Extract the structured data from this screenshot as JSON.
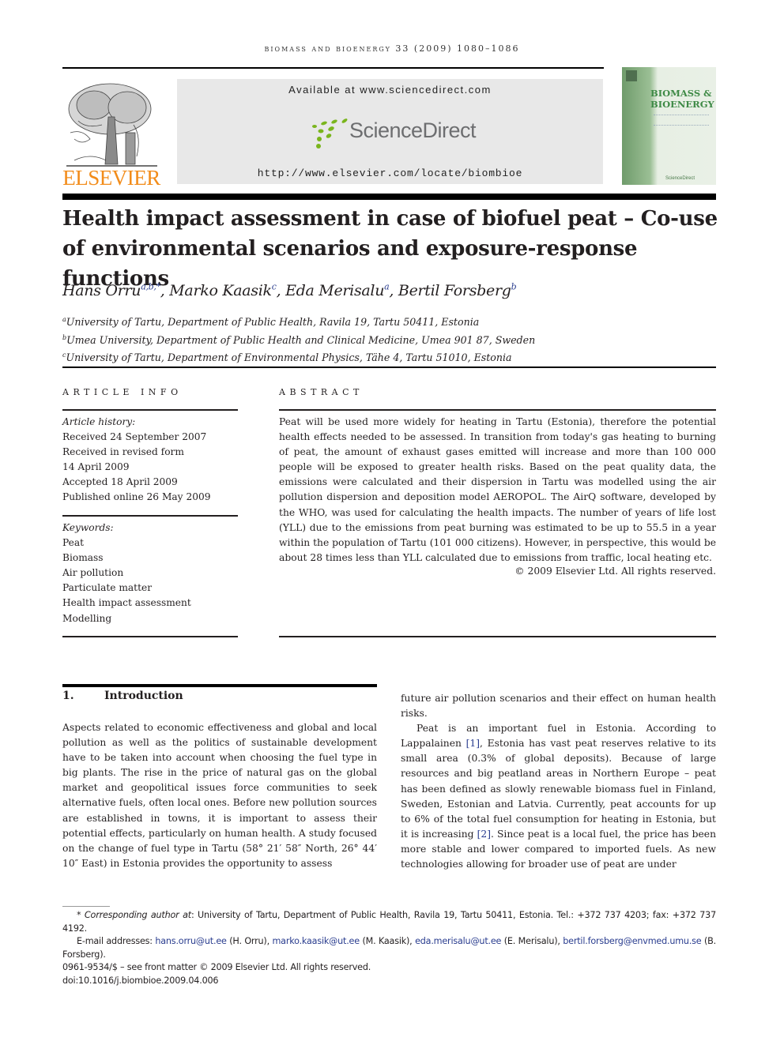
{
  "running_head": "biomass and bioenergy 33 (2009) 1080–1086",
  "publisher": {
    "name": "ELSEVIER",
    "brand_color": "#f28c1a"
  },
  "sciencedirect": {
    "available_at": "Available at www.sciencedirect.com",
    "logo_text": "ScienceDirect",
    "logo_color": "#7ab51d",
    "journal_url": "http://www.elsevier.com/locate/biombioe"
  },
  "journal_cover": {
    "title_line1": "BIOMASS &",
    "title_line2": "BIOENERGY",
    "footer": "ScienceDirect"
  },
  "article": {
    "title": "Health impact assessment in case of biofuel peat – Co-use of environmental scenarios and exposure-response functions",
    "authors": [
      {
        "name": "Hans Orru",
        "sup": "a,b,*",
        "sep": ", "
      },
      {
        "name": "Marko Kaasik",
        "sup": "c",
        "sep": ", "
      },
      {
        "name": "Eda Merisalu",
        "sup": "a",
        "sep": ", "
      },
      {
        "name": "Bertil Forsberg",
        "sup": "b",
        "sep": ""
      }
    ],
    "affiliations": [
      {
        "key": "a",
        "text": "University of Tartu, Department of Public Health, Ravila 19, Tartu 50411, Estonia"
      },
      {
        "key": "b",
        "text": "Umea University, Department of Public Health and Clinical Medicine, Umea 901 87, Sweden"
      },
      {
        "key": "c",
        "text": "University of Tartu, Department of Environmental Physics, Tähe 4, Tartu 51010, Estonia"
      }
    ]
  },
  "article_info": {
    "heading": "ARTICLE INFO",
    "history_label": "Article history:",
    "history": [
      "Received 24 September 2007",
      "Received in revised form",
      "14 April 2009",
      "Accepted 18 April 2009",
      "Published online 26 May 2009"
    ],
    "keywords_label": "Keywords:",
    "keywords": [
      "Peat",
      "Biomass",
      "Air pollution",
      "Particulate matter",
      "Health impact assessment",
      "Modelling"
    ]
  },
  "abstract": {
    "heading": "ABSTRACT",
    "text": "Peat will be used more widely for heating in Tartu (Estonia), therefore the potential health effects needed to be assessed. In transition from today's gas heating to burning of peat, the amount of exhaust gases emitted will increase and more than 100 000 people will be exposed to greater health risks. Based on the peat quality data, the emissions were calculated and their dispersion in Tartu was modelled using the air pollution dispersion and deposition model AEROPOL. The AirQ software, developed by the WHO, was used for calculating the health impacts. The number of years of life lost (YLL) due to the emissions from peat burning was estimated to be up to 55.5 in a year within the population of Tartu (101 000 citizens). However, in perspective, this would be about 28 times less than YLL calculated due to emissions from traffic, local heating etc.",
    "copyright": "© 2009 Elsevier Ltd. All rights reserved."
  },
  "introduction": {
    "number": "1.",
    "heading": "Introduction",
    "left_col": "Aspects related to economic effectiveness and global and local pollution as well as the politics of sustainable development have to be taken into account when choosing the fuel type in big plants. The rise in the price of natural gas on the global market and geopolitical issues force communities to seek alternative fuels, often local ones. Before new pollution sources are established in towns, it is important to assess their potential effects, particularly on human health. A study focused on the change of fuel type in Tartu (58° 21′ 58″ North, 26° 44′ 10″ East) in Estonia provides the opportunity to assess",
    "right_col_p1": "future air pollution scenarios and their effect on human health risks.",
    "right_col_p2_a": "Peat is an important fuel in Estonia. According to Lappalainen ",
    "ref1": "[1]",
    "right_col_p2_b": ", Estonia has vast peat reserves relative to its small area (0.3% of global deposits). Because of large resources and big peatland areas in Northern Europe – peat has been defined as slowly renewable biomass fuel in Finland, Sweden, Estonian and Latvia. Currently, peat accounts for up to 6% of the total fuel consumption for heating in Estonia, but it is increasing ",
    "ref2": "[2]",
    "right_col_p2_c": ". Since peat is a local fuel, the price has been more stable and lower compared to imported fuels. As new technologies allowing for broader use of peat are under"
  },
  "footnotes": {
    "corresponding_label": "* Corresponding author at",
    "corresponding_text": ": University of Tartu, Department of Public Health, Ravila 19, Tartu 50411, Estonia. Tel.: +372 737 4203; fax: +372 737 4192.",
    "email_label": "E-mail addresses: ",
    "emails": [
      {
        "address": "hans.orru@ut.ee",
        "who": " (H. Orru), "
      },
      {
        "address": "marko.kaasik@ut.ee",
        "who": " (M. Kaasik), "
      },
      {
        "address": "eda.merisalu@ut.ee",
        "who": " (E. Merisalu), "
      },
      {
        "address": "bertil.forsberg@envmed.umu.se",
        "who": " (B. Forsberg)."
      }
    ],
    "issn": "0961-9534/$ – see front matter © 2009 Elsevier Ltd. All rights reserved.",
    "doi": "doi:10.1016/j.biombioe.2009.04.006"
  }
}
